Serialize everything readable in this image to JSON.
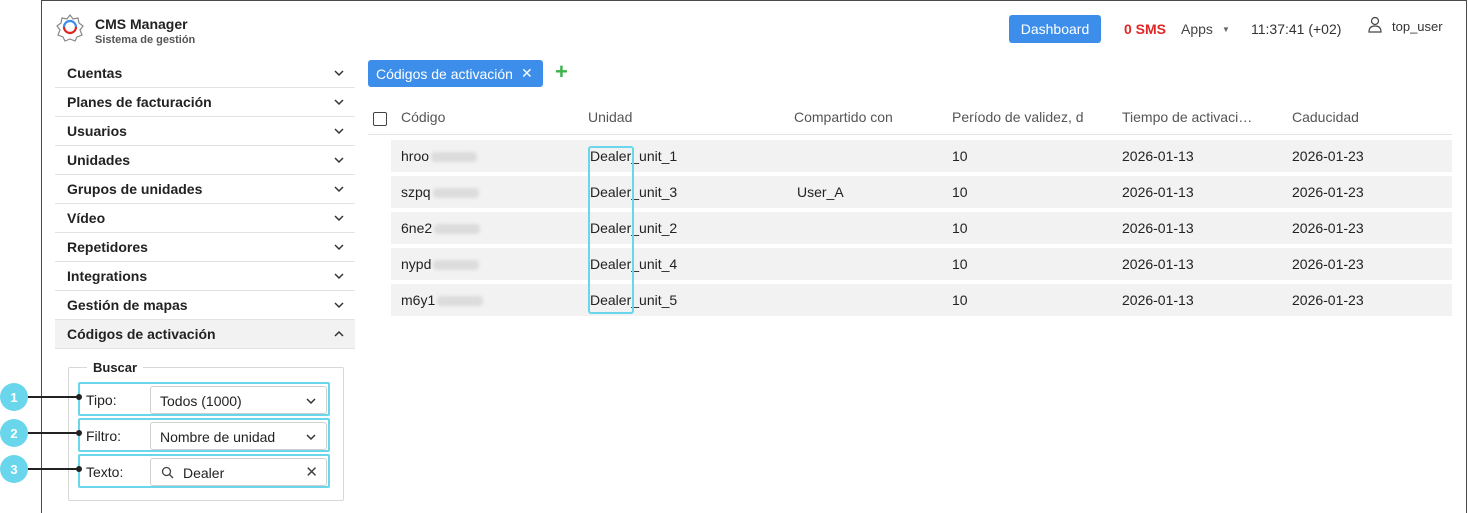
{
  "header": {
    "app_title": "CMS Manager",
    "app_subtitle": "Sistema de gestión",
    "dashboard_label": "Dashboard",
    "sms_label": "0 SMS",
    "apps_label": "Apps",
    "clock": "11:37:41 (+02)",
    "username": "top_user"
  },
  "sidebar": {
    "items": [
      {
        "label": "Cuentas"
      },
      {
        "label": "Planes de facturación"
      },
      {
        "label": "Usuarios"
      },
      {
        "label": "Unidades"
      },
      {
        "label": "Grupos de unidades"
      },
      {
        "label": "Vídeo"
      },
      {
        "label": "Repetidores"
      },
      {
        "label": "Integrations"
      },
      {
        "label": "Gestión de mapas"
      },
      {
        "label": "Códigos de activación"
      }
    ],
    "search": {
      "legend": "Buscar",
      "tipo_label": "Tipo:",
      "tipo_value": "Todos (1000)",
      "filtro_label": "Filtro:",
      "filtro_value": "Nombre de unidad",
      "texto_label": "Texto:",
      "texto_value": "Dealer"
    }
  },
  "callouts": [
    "1",
    "2",
    "3"
  ],
  "main": {
    "tab_label": "Códigos de activación",
    "add_symbol": "+",
    "columns": [
      "Código",
      "Unidad",
      "Compartido con",
      "Período de validez, d",
      "Tiempo de activaci…",
      "Caducidad"
    ],
    "rows": [
      {
        "code": "hroo",
        "unit": "Dealer_unit_1",
        "shared": "",
        "validity": "10",
        "activation": "2026-01-13",
        "expiry": "2026-01-23"
      },
      {
        "code": "szpq",
        "unit": "Dealer_unit_3",
        "shared": "User_A",
        "validity": "10",
        "activation": "2026-01-13",
        "expiry": "2026-01-23"
      },
      {
        "code": "6ne2",
        "unit": "Dealer_unit_2",
        "shared": "",
        "validity": "10",
        "activation": "2026-01-13",
        "expiry": "2026-01-23"
      },
      {
        "code": "nypd",
        "unit": "Dealer_unit_4",
        "shared": "",
        "validity": "10",
        "activation": "2026-01-13",
        "expiry": "2026-01-23"
      },
      {
        "code": "m6y1",
        "unit": "Dealer_unit_5",
        "shared": "",
        "validity": "10",
        "activation": "2026-01-13",
        "expiry": "2026-01-23"
      }
    ]
  },
  "colors": {
    "accent": "#3d8eea",
    "highlight": "#6ad6ec",
    "sms": "#e02525",
    "add": "#3cb34a"
  }
}
